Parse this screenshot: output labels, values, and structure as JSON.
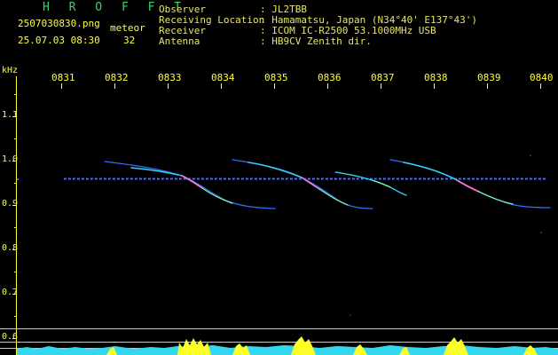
{
  "header": {
    "app_title": "H R O F F T",
    "filename": "2507030830.png",
    "datetime": "25.07.03 08:30",
    "count_label": "meteor",
    "count_value": "32"
  },
  "info": {
    "labels": [
      "Observer",
      "Receiving Location",
      "Receiver",
      "Antenna"
    ],
    "values": [
      ": JL2TBB",
      ": Hamamatsu, Japan (N34°40' E137°43')",
      ": ICOM IC-R2500 53.1000MHz USB",
      ": HB9CV Zenith dir."
    ]
  },
  "axis": {
    "unit": "kHz",
    "time_ticks": [
      "0831",
      "0832",
      "0833",
      "0834",
      "0835",
      "0836",
      "0837",
      "0838",
      "0839",
      "0840"
    ],
    "freq_ticks": [
      "1.1",
      "1.0",
      "0.9",
      "0.8",
      "0.7",
      "0.6"
    ]
  },
  "colors": {
    "background": "#000000",
    "axis_text": "#ffff3a",
    "title": "#37d66b",
    "carrier": "#3a5cff",
    "echo": "#35d2ff",
    "bottom_cyan": "#33d8ef",
    "bottom_yellow": "#ffff28"
  }
}
